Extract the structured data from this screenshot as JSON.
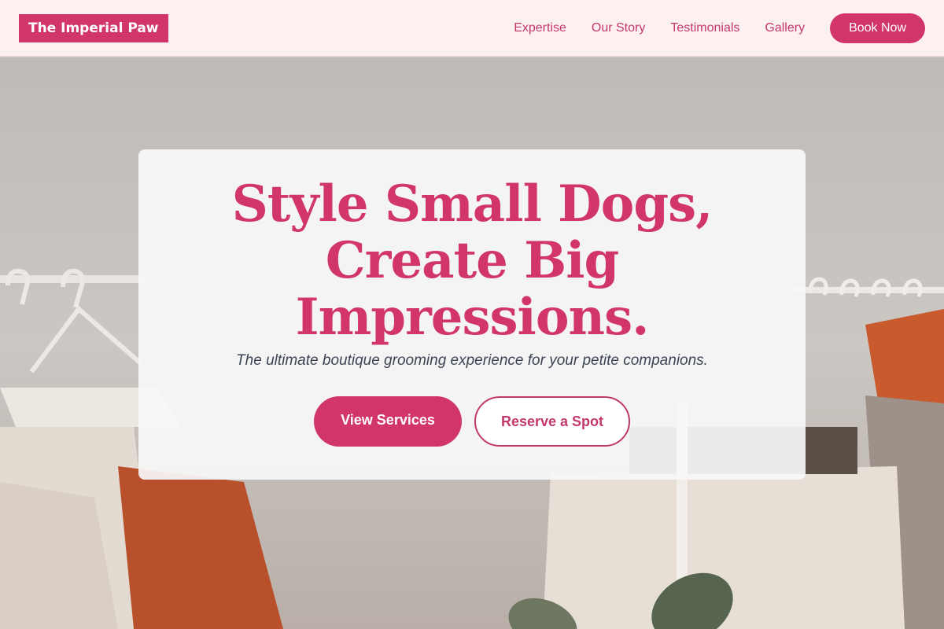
{
  "header": {
    "brand": "The Imperial Paw",
    "nav": [
      {
        "label": "Expertise"
      },
      {
        "label": "Our Story"
      },
      {
        "label": "Testimonials"
      },
      {
        "label": "Gallery"
      }
    ],
    "book_label": "Book Now"
  },
  "hero": {
    "headline": "Style Small Dogs, Create Big Impressions.",
    "subline": "The ultimate boutique grooming experience for your petite companions.",
    "primary_label": "View Services",
    "secondary_label": "Reserve a Spot",
    "background_image": "clothing rack with hangers, orange sweater, cream trousers and a plant"
  },
  "colors": {
    "accent": "#d1356b",
    "header_bg": "#fdf0f1",
    "subtext": "#3c4453"
  }
}
